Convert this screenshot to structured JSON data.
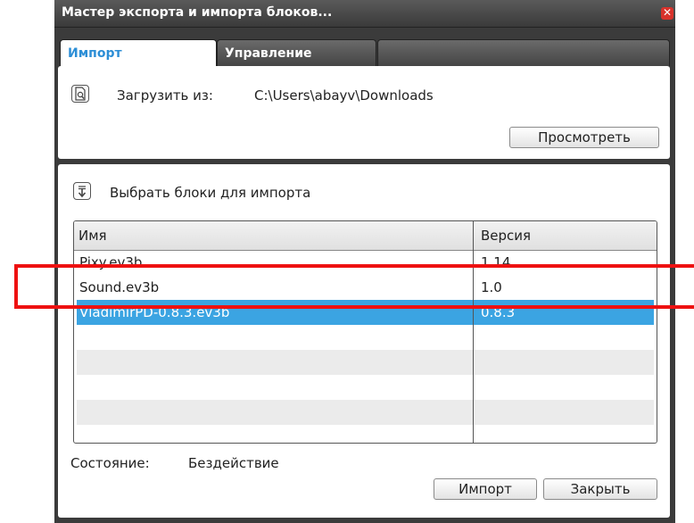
{
  "window": {
    "title": "Мастер экспорта и импорта блоков...",
    "close_glyph": "✕"
  },
  "tabs": [
    {
      "label": "Импорт",
      "active": true
    },
    {
      "label": "Управление",
      "active": false
    }
  ],
  "load": {
    "label": "Загрузить из:",
    "path": "C:\\Users\\abayv\\Downloads",
    "browse_button": "Просмотреть",
    "icon": "document-search-icon"
  },
  "select": {
    "label": "Выбрать блоки для импорта",
    "icon": "download-arrow-icon"
  },
  "table": {
    "columns": [
      "Имя",
      "Версия"
    ],
    "rows": [
      {
        "name": "Pixy.ev3b",
        "version": "1.14"
      },
      {
        "name": "Sound.ev3b",
        "version": "1.0"
      },
      {
        "name": "VladimirPD-0.8.3.ev3b",
        "version": "0.8.3",
        "selected": true
      }
    ]
  },
  "status": {
    "label": "Состояние:",
    "value": "Бездействие"
  },
  "buttons": {
    "import": "Импорт",
    "close": "Закрыть"
  },
  "colors": {
    "accent": "#2c8ed6",
    "selection": "#3ba4e2",
    "annotation": "#ee1111"
  }
}
